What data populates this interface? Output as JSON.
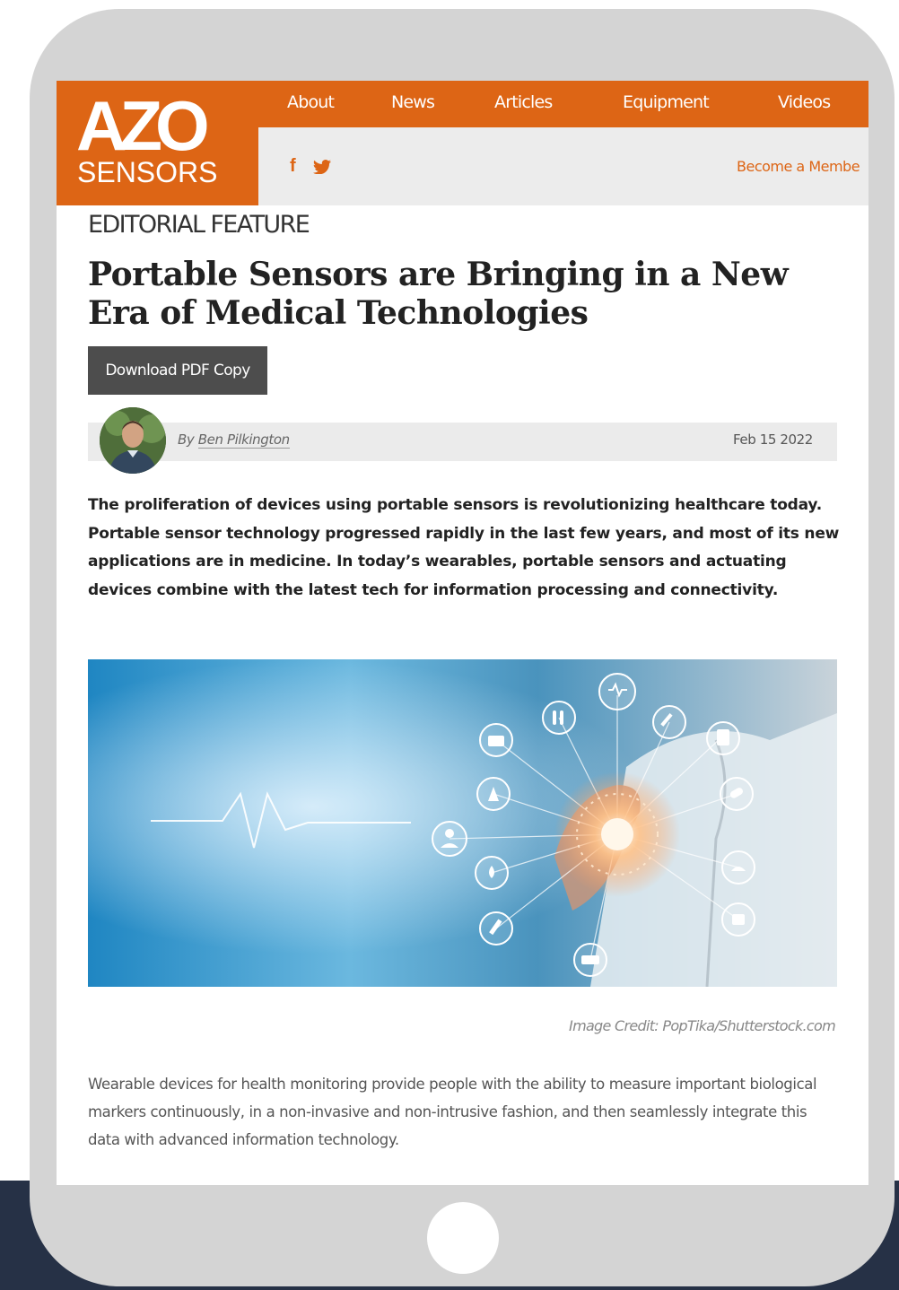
{
  "logo": {
    "line1": "AZO",
    "line2": "SENSORS"
  },
  "nav": {
    "items": [
      "About",
      "News",
      "Articles",
      "Equipment",
      "Videos"
    ]
  },
  "subbar": {
    "facebook_glyph": "f",
    "twitter_glyph": "🐦",
    "member_link": "Become a Membe"
  },
  "article": {
    "eyebrow": "EDITORIAL FEATURE",
    "title": "Portable Sensors are Bringing in a New Era of Medical Technologies",
    "pdf_button": "Download PDF Copy",
    "byline_prefix": "By",
    "author": "Ben Pilkington",
    "date": "Feb 15 2022",
    "lead": "The proliferation of devices using portable sensors is revolutionizing healthcare today. Portable sensor technology progressed rapidly in the last few years, and most of its new applications are in medicine. In today’s wearables, portable sensors and actuating devices combine with the latest tech for information processing and connectivity.",
    "image_credit": "Image Credit: PopTika/Shutterstock.com",
    "body": "Wearable devices for health monitoring provide people with the ability to measure important biological markers continuously, in a non-invasive and non-intrusive fashion, and then seamlessly integrate this data with advanced information technology."
  },
  "icons": {
    "hero_nodes": [
      "heart-rate-icon",
      "test-tubes-icon",
      "syringe-icon",
      "clipboard-icon",
      "first-aid-kit-icon",
      "flask-icon",
      "pill-icon",
      "doctor-icon",
      "drop-icon",
      "vial-icon",
      "ambulance-icon"
    ]
  },
  "colors": {
    "brand_orange": "#dd6515",
    "tablet_frame": "#d4d4d4",
    "background_navy": "#263146",
    "button_gray": "#4d4d4d"
  }
}
